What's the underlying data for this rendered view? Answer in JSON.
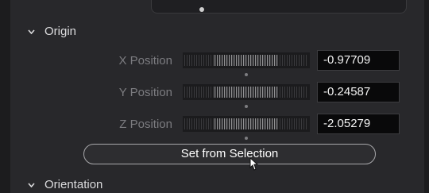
{
  "sections": {
    "origin_label": "Origin",
    "orientation_label": "Orientation"
  },
  "fields": [
    {
      "label": "X Position",
      "value": "-0.97709"
    },
    {
      "label": "Y Position",
      "value": "-0.24587"
    },
    {
      "label": "Z Position",
      "value": "-2.05279"
    }
  ],
  "button": {
    "label": "Set from Selection"
  },
  "icons": {
    "origin_chevron": "chevron-down-icon",
    "orientation_chevron": "chevron-down-icon",
    "cursor": "mouse-pointer-icon"
  }
}
